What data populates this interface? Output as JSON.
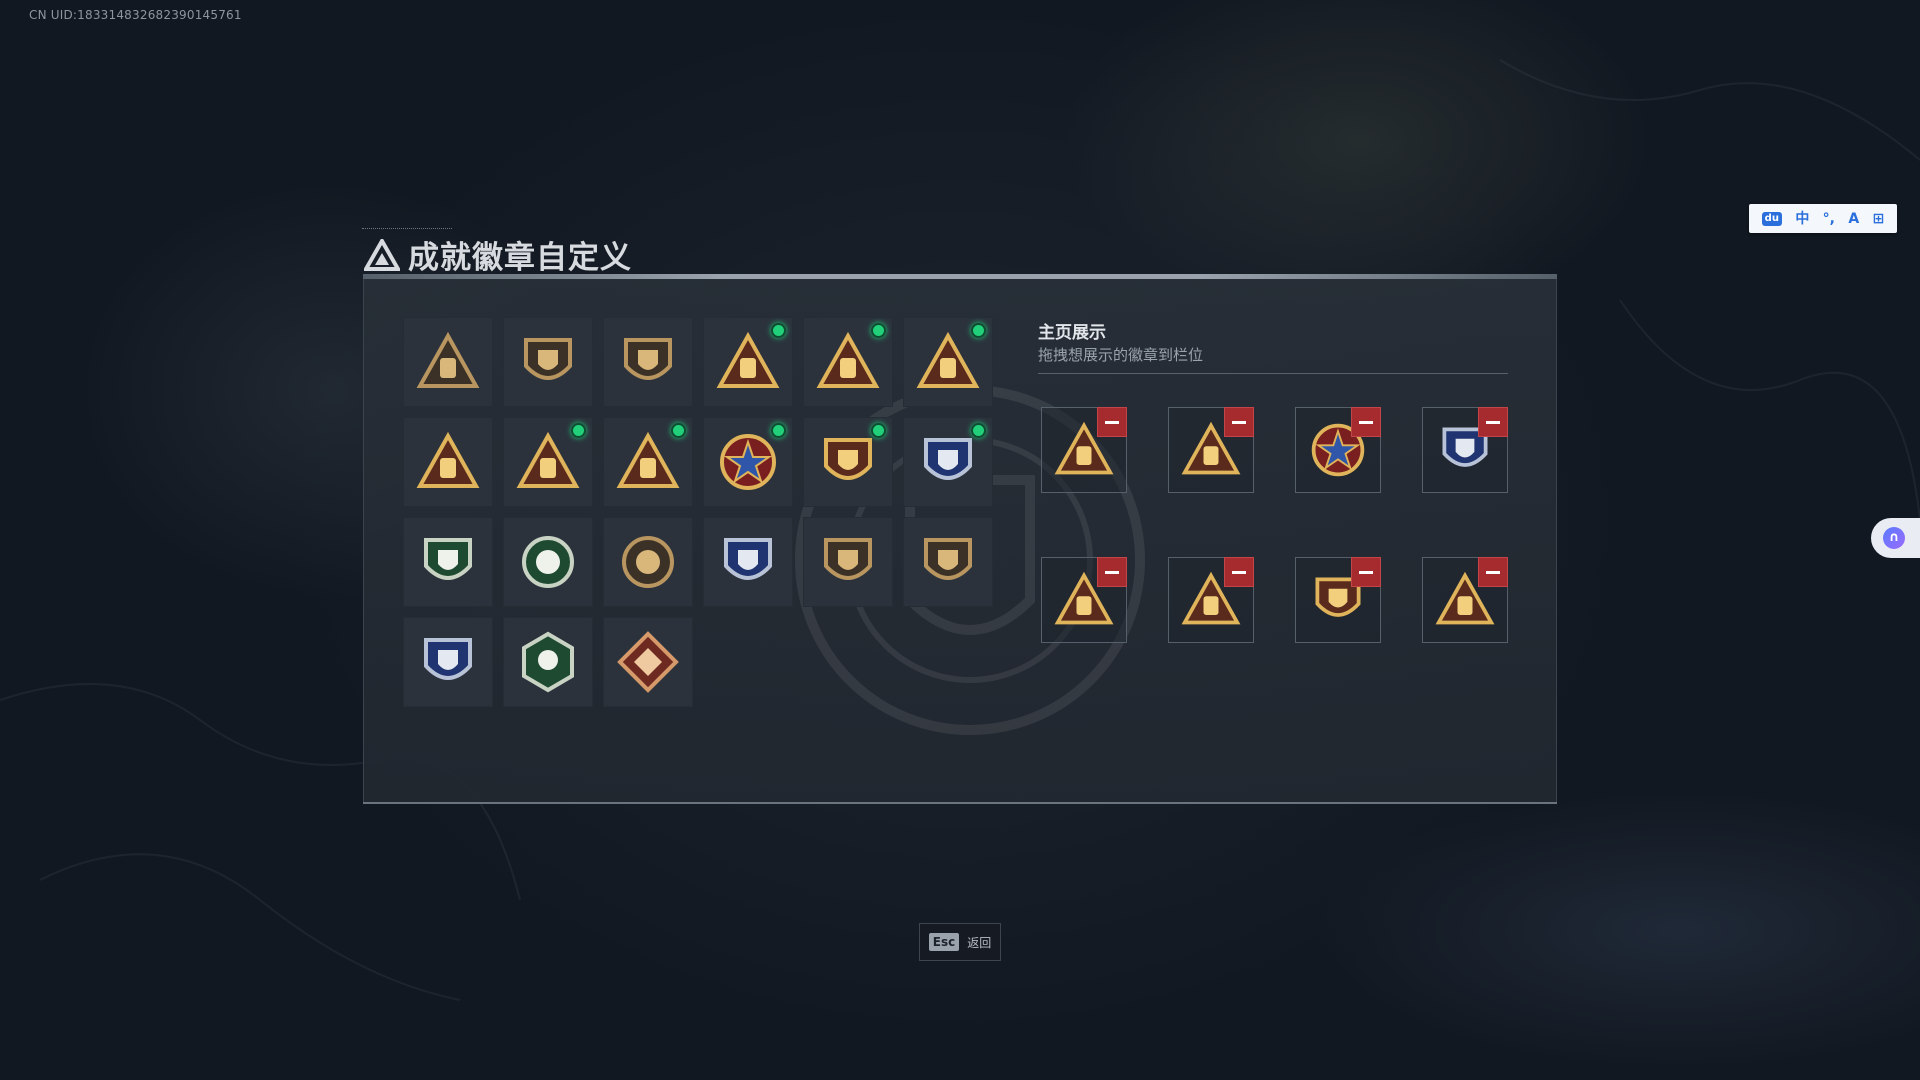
{
  "uid_text": "CN UID:183314832682390145761",
  "title": "成就徽章自定义",
  "ime": {
    "items": [
      "du",
      "中",
      "°,",
      "A",
      "⊞"
    ]
  },
  "display": {
    "title": "主页展示",
    "subtitle": "拖拽想展示的徽章到栏位"
  },
  "esc": {
    "key": "Esc",
    "label": "返回"
  },
  "badges": [
    {
      "icon": "triangle-logo-icon",
      "theme": "bronze",
      "new": false
    },
    {
      "icon": "helicopter-icon",
      "theme": "bronze",
      "new": false
    },
    {
      "icon": "dagger-shield-icon",
      "theme": "bronze",
      "new": false
    },
    {
      "icon": "sack-55-icon",
      "theme": "gold",
      "new": true
    },
    {
      "icon": "bag-56-icon",
      "theme": "gold",
      "new": true
    },
    {
      "icon": "hat-triangle-icon",
      "theme": "gold",
      "new": true
    },
    {
      "icon": "number-one-icon",
      "theme": "gold",
      "new": false
    },
    {
      "icon": "crate-triangle-icon",
      "theme": "gold",
      "new": true
    },
    {
      "icon": "soldier-triangle-icon",
      "theme": "gold",
      "new": true
    },
    {
      "icon": "star-medal-icon",
      "theme": "star",
      "new": true
    },
    {
      "icon": "shield-drop-icon",
      "theme": "gold",
      "new": true
    },
    {
      "icon": "blue-shield-icon",
      "theme": "blue",
      "new": true
    },
    {
      "icon": "green-shield-icon",
      "theme": "green",
      "new": false
    },
    {
      "icon": "green-wreath-icon",
      "theme": "green",
      "new": false
    },
    {
      "icon": "sunburst-vehicle-icon",
      "theme": "bronze",
      "new": false
    },
    {
      "icon": "crosshair-shield-icon",
      "theme": "blue",
      "new": false
    },
    {
      "icon": "rifle-shield-icon",
      "theme": "bronze",
      "new": false
    },
    {
      "icon": "sniper-shield-icon",
      "theme": "bronze",
      "new": false
    },
    {
      "icon": "crossed-shield-icon",
      "theme": "blue",
      "new": false
    },
    {
      "icon": "hex-soldier-icon",
      "theme": "green",
      "new": false
    },
    {
      "icon": "dragon-diamond-icon",
      "theme": "red",
      "new": false
    }
  ],
  "showcase": [
    {
      "icon": "sack-55-icon",
      "theme": "gold"
    },
    {
      "icon": "crate-triangle-icon",
      "theme": "gold"
    },
    {
      "icon": "star-medal-icon",
      "theme": "star"
    },
    {
      "icon": "blue-shield-icon",
      "theme": "blue"
    },
    {
      "icon": "soldier-triangle-icon",
      "theme": "gold"
    },
    {
      "icon": "bag-56-icon",
      "theme": "gold"
    },
    {
      "icon": "shield-drop-icon",
      "theme": "gold"
    },
    {
      "icon": "hat-triangle-icon",
      "theme": "gold"
    }
  ],
  "colors": {
    "new_indicator": "#22d07a",
    "remove_button": "#a52b2f",
    "panel_bg": "#283038"
  }
}
